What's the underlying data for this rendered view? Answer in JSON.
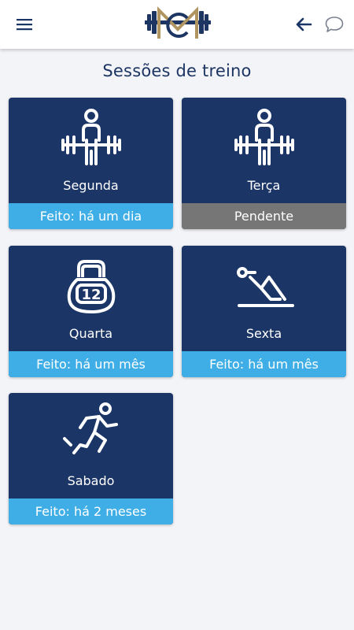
{
  "header": {
    "menu_icon": "hamburger-menu-icon",
    "logo": "gym-logo-dumbbell-m",
    "back_icon": "arrow-left-icon",
    "chat_icon": "chat-bubble-icon"
  },
  "page": {
    "title": "Sessões de treino"
  },
  "colors": {
    "card_bg": "#1b3566",
    "status_done": "#3faee6",
    "status_pending": "#767676",
    "title": "#1d3563"
  },
  "sessions": [
    {
      "day": "Segunda",
      "status": "Feito: há um dia",
      "state": "done",
      "icon": "weightlifter-icon"
    },
    {
      "day": "Terça",
      "status": "Pendente",
      "state": "pending",
      "icon": "weightlifter-icon"
    },
    {
      "day": "Quarta",
      "status": "Feito: há um mês",
      "state": "done",
      "icon": "kettlebell-12-icon"
    },
    {
      "day": "Sexta",
      "status": "Feito: há um mês",
      "state": "done",
      "icon": "situp-exercise-icon"
    },
    {
      "day": "Sabado",
      "status": "Feito: há 2 meses",
      "state": "done",
      "icon": "runner-icon"
    }
  ]
}
